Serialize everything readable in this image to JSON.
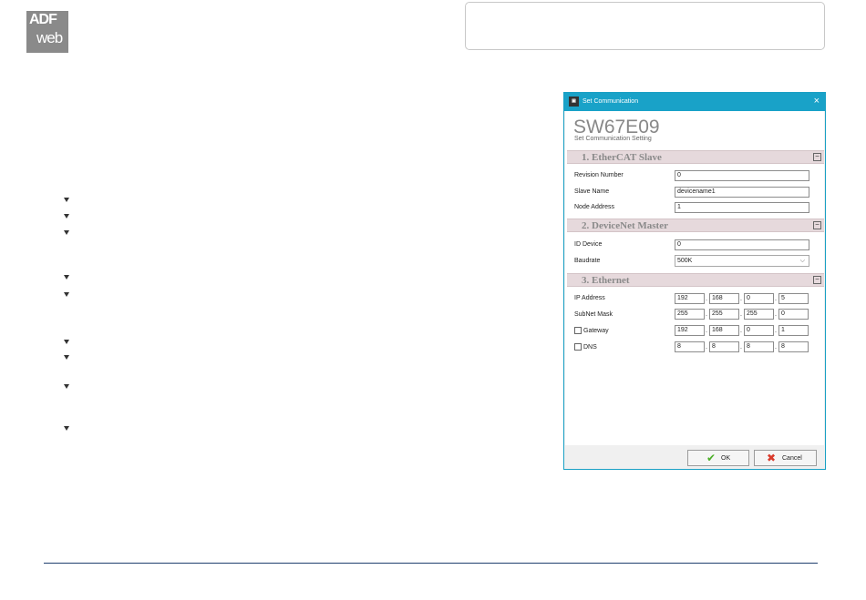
{
  "logo": {
    "line1": "ADF",
    "line2": "web"
  },
  "bullets_count": 9,
  "dialog": {
    "title": "Set Communication",
    "title_icon": "app-icon",
    "close_glyph": "×",
    "heading": "SW67E09",
    "subheading": "Set Communication Setting",
    "sections": {
      "ethercat": {
        "title": "1. EtherCAT Slave",
        "collapse_glyph": "−",
        "revision_label": "Revision Number",
        "revision_value": "0",
        "slave_name_label": "Slave Name",
        "slave_name_value": "devicename1",
        "node_address_label": "Node Address",
        "node_address_value": "1"
      },
      "devicenet": {
        "title": "2. DeviceNet Master",
        "collapse_glyph": "−",
        "id_device_label": "ID Device",
        "id_device_value": "0",
        "baudrate_label": "Baudrate",
        "baudrate_value": "500K",
        "baudrate_arrow": "⌵"
      },
      "ethernet": {
        "title": "3. Ethernet",
        "collapse_glyph": "−",
        "ip_label": "IP Address",
        "ip": [
          "192",
          "168",
          "0",
          "5"
        ],
        "subnet_label": "SubNet Mask",
        "subnet": [
          "255",
          "255",
          "255",
          "0"
        ],
        "gateway_label": "Gateway",
        "gateway_checked": false,
        "gateway": [
          "192",
          "168",
          "0",
          "1"
        ],
        "dns_label": "DNS",
        "dns_checked": false,
        "dns": [
          "8",
          "8",
          "8",
          "8"
        ],
        "dot": "."
      }
    },
    "buttons": {
      "ok_label": "OK",
      "ok_icon": "✔",
      "cancel_label": "Cancel",
      "cancel_icon": "✖"
    }
  },
  "colors": {
    "titlebar": "#19a2c8",
    "section_bg": "#e6d9dc",
    "footer_line": "#1f3f6e",
    "ok_icon": "#4caf28",
    "cancel_icon": "#d93a2b"
  }
}
